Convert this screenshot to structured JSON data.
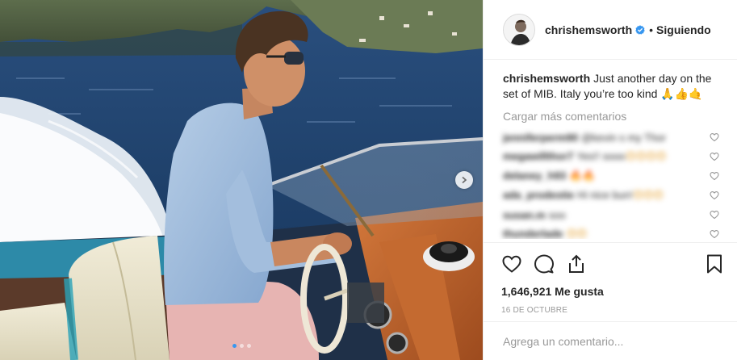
{
  "post": {
    "username": "chrishemsworth",
    "verified": true,
    "separator": "•",
    "follow_status": "Siguiendo",
    "caption_text": "Just another day on the set of MIB. Italy you’re too kind 🙏👍🤙",
    "load_more": "Cargar más comentarios",
    "likes": "1,646,921 Me gusta",
    "date": "16 DE OCTUBRE",
    "comment_placeholder": "Agrega un comentario...",
    "carousel": {
      "slides": 3,
      "active_slide": 1
    }
  },
  "comments": [
    {
      "user": "jenniferperm90",
      "text": "@kevin s my Thor",
      "emoji": ""
    },
    {
      "user": "megawillthor7",
      "text": "Yes!! sooo",
      "emoji": "😍😍😍😍"
    },
    {
      "user": "delaney_h93",
      "text": "🔥🔥",
      "emoji": ""
    },
    {
      "user": "ada_prodestie",
      "text": "Hi nice bun!",
      "emoji": "😍😍😍"
    },
    {
      "user": "susan.m",
      "text": "soo",
      "emoji": ""
    },
    {
      "user": "thunderlade",
      "text": "",
      "emoji": "😍😍"
    }
  ],
  "icons": {
    "verified": "verified-badge-icon",
    "like": "heart-icon",
    "comment": "comment-bubble-icon",
    "share": "share-upload-icon",
    "save": "bookmark-icon",
    "comment_like": "heart-icon",
    "carousel_next": "chevron-right-icon"
  },
  "colors": {
    "verified_blue": "#3897f0",
    "text": "#262626",
    "muted": "#999999",
    "border": "#efefef"
  }
}
